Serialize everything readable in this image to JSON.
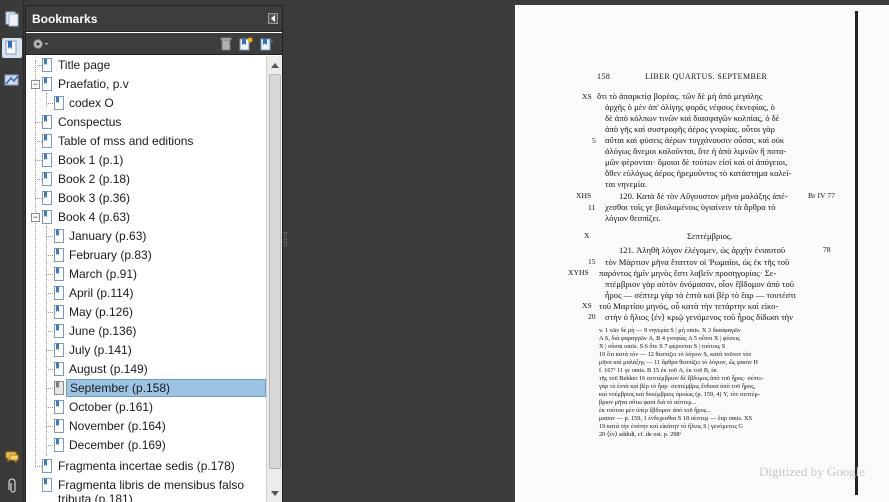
{
  "panel": {
    "title": "Bookmarks",
    "colors": {
      "selected_bg": "#9cc4e4",
      "header_bg": "#3d3d3d",
      "bookmark_blue": "#3c78c3"
    }
  },
  "strip_icons": [
    "pages-icon",
    "bookmarks-icon",
    "signatures-icon",
    "comments-icon",
    "attachments-icon"
  ],
  "toolbar_icons": [
    "options-gear-icon",
    "delete-bookmark-icon",
    "new-bookmark-icon",
    "expand-bookmark-icon"
  ],
  "bookmarks": [
    {
      "label": "Title page"
    },
    {
      "label": "Praefatio, p.v"
    },
    {
      "label": "codex O"
    },
    {
      "label": "Conspectus"
    },
    {
      "label": "Table of mss and editions"
    },
    {
      "label": "Book 1 (p.1)"
    },
    {
      "label": "Book 2 (p.18)"
    },
    {
      "label": "Book 3 (p.36)"
    },
    {
      "label": "Book 4 (p.63)"
    },
    {
      "label": "January (p.63)"
    },
    {
      "label": "February (p.83)"
    },
    {
      "label": "March (p.91)"
    },
    {
      "label": "April (p.114)"
    },
    {
      "label": "May (p.126)"
    },
    {
      "label": "June (p.136)"
    },
    {
      "label": "July (p.141)"
    },
    {
      "label": "August (p.149)"
    },
    {
      "label": "September (p.158)"
    },
    {
      "label": "October (p.161)"
    },
    {
      "label": "November (p.164)"
    },
    {
      "label": "December (p.169)"
    },
    {
      "label": "Fragmenta incertae sedis (p.178)"
    },
    {
      "label": "Fragmenta libris de mensibus falso"
    },
    {
      "label": "tributa (p.181)"
    }
  ],
  "page": {
    "number": "158",
    "header": "LIBER QUARTUS. SEPTEMBER",
    "lines": [
      "ὅτι τὸ ἀπαρκτίᾳ βορέας. τῶν δὲ μὴ ἀπὸ μεγάλης",
      "ἀρχῆς ὁ μὲν ἀπ' ὀλίγης φορᾶς νέφους ἐκνεφίας, ὁ",
      "δὲ ἀπὸ κόλπων τινῶν καὶ διασφαγῶν κολπίας, ὁ δὲ",
      "ἀπὸ γῆς καὶ συστροφῆς ἀέρος γνοφίας. οὗτοι γὰρ",
      "αὔται καὶ φύσεις ἀέρων τυγχάνουσιν οὖσαι, καὶ οὐκ",
      "ἀλόγως ἄνεμοι καλοῦνται, ὅτε ἡ ἀπὸ λιμνῶν ἢ ποτα-",
      "μῶν φέρονται· ὅμοιοι δὲ τούτων εἰσὶ καὶ οἱ ἀπόγειοι,",
      "ὅθεν εὐλόγως ἀέρος ἠρεμοῦντος τὸ κατάστημα καλεῖ-",
      "ται νηνεμία.",
      "120. Κατὰ δὲ τὸν Αὔγουστον μῆνα μαλάξης ἀπέ-",
      "χεσθαι τοῖς γε βουλομένοις ὑγιαίνειν τὰ ἄρθρα τὸ",
      "λόγιον θεσπίζει.",
      "Σεπτέμβριος.",
      "121. Ἀληθῆ λόγον ἐλέγομεν, ὡς ἀρχὴν ἐνιαυτοῦ",
      "τὸν Μάρτιον μῆνα ἔταττον οἱ Ῥωμαῖοι, ὡς ἐκ τῆς τοῦ",
      "παρόντος ἡμῖν μηνὸς ἔστι λαβεῖν προσηγορίας· Σε-",
      "πτέμβριον γὰρ αὐτὸν ὀνόμασαν, οἷον ἕβδομον ἀπὸ τοῦ",
      "ἦρος — σέπτεμ γὰρ τὰ ἑπτὰ καὶ βὲρ τὸ ἔαρ — τουτέστι",
      "τοῦ Μαρτίου μηνός, οὗ κατὰ τὴν τετάρτην καὶ εἰκο-",
      "στὴν ὁ ἥλιος ⟨ἐν⟩ κριῷ γενόμενος τοῦ ἦρος δίδωσι τὴν"
    ],
    "margins": [
      "XS",
      "5",
      "XHS",
      "11",
      "X",
      "78",
      "15",
      "XYHS",
      "XS",
      "20"
    ],
    "margin_note": "Br IV 77",
    "apparatus": [
      "v. 1 τῶν δὲ μὴ — 9 νηνεμία S | μὴ omis. X   3 διασφαγῶν",
      "A S, διὰ φαραγγῶν A, B   4 γνοφίας A   5 οὗτοι X | φύσεις",
      "X | οὖσαι omis. S   6 ὅτε S   7 φέρονται S | τούτοις S",
      "10 ὅτι κατὰ τὸν — 12 θεσπίζει τὸ λόγιον S, κατὰ τοῦτον τὸν",
      "μῆνα καὶ μαλάξης — 11 ἄρθρα θεσπίζει τὸ λόγιον, ὥς φασιν H",
      "f. 167ᵛ   11 γε omis. B   15 ἐκ τοῦ A, ἐκ τοῦ B, ἐκ",
      "τῆς τοῦ Bekker   16 σεπτέμβριον δὲ ἕβδομος ἀπὸ τοῦ ἦρος· σέπτε-",
      "γὰρ τὸ ἑπτὰ καὶ βὲρ τὸ ἦαρ· σεπτέμβρις ἕνδεκα ἀπὸ τοῦ ἦρος,",
      "καὶ νοέμβριος καὶ δεκέμβριος ὁμοίως (p. 159, 4) Y, τὸν σεπτέμ-",
      "βριον μῆνα οὕτω φασὶ διὰ τὸ σέπτεμ...",
      "ἐκ τούτου μὲν ὑπὲρ ἕβδομον ἀπὸ τοῦ ἦρος...",
      "μασαν — p. 159, 1 ἐνδεχεσθαι S   18 σέπτεμ — ἔαρ omis. XS",
      "19 κατὰ τὴν ἐνάτην καὶ εἰκάτην τὸ ἥλιος S | γενόμενος G",
      "20 ⟨ἐν⟩ addidi, cf. de ost. p. 298ᵛ"
    ],
    "watermark": "Digitized by Google"
  }
}
